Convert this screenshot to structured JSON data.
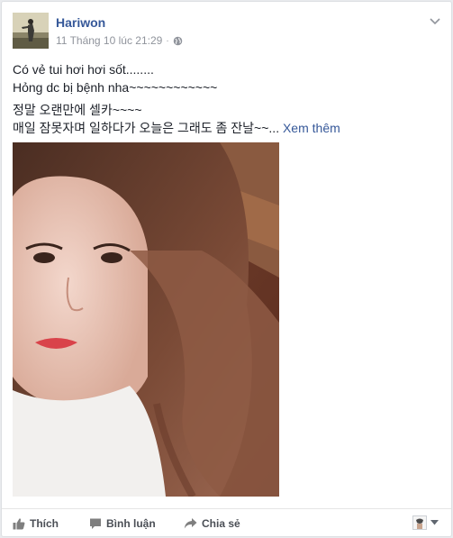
{
  "post": {
    "author": "Hariwon",
    "timestamp": "11 Tháng 10 lúc 21:29",
    "separator": "·",
    "privacy_icon": "globe-icon",
    "lines": [
      "Có vẻ tui hơi hơi sốt........",
      "Hỏng dc bị bệnh nha~~~~~~~~~~~~",
      "정말 오랜만에 셀카~~~~",
      "매일 잠못자며 일하다가 오늘은 그래도 좀 잔날~~..."
    ],
    "see_more": "Xem thêm"
  },
  "actions": {
    "like": "Thích",
    "comment": "Bình luận",
    "share": "Chia sẻ"
  },
  "colors": {
    "link": "#365899",
    "meta": "#90949c",
    "text": "#1d2129",
    "action": "#4b4f56",
    "border": "#dddfe2"
  }
}
